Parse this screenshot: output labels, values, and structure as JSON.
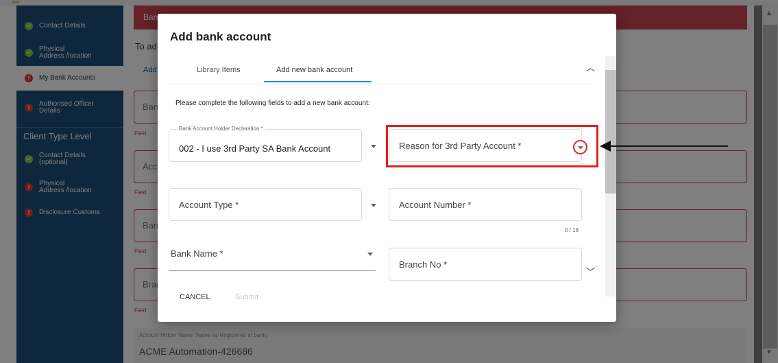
{
  "sidebar": {
    "items": [
      {
        "label": "Contact Details",
        "status": "ok",
        "active": false
      },
      {
        "label": "Physical\nAddress /location",
        "status": "ok",
        "active": false
      },
      {
        "label": "My Bank Accounts",
        "status": "error",
        "active": true
      },
      {
        "label": "Authorised Officer\nDetails",
        "status": "error",
        "active": false
      }
    ],
    "section_title": "Client Type Level",
    "section_items": [
      {
        "label": "Contact Details\n(optional)",
        "status": "ok"
      },
      {
        "label": "Physical\nAddress /location",
        "status": "error"
      },
      {
        "label": "Disclosure Customs",
        "status": "error"
      }
    ]
  },
  "background": {
    "banner_text": "Ban",
    "intro_text": "To ad",
    "add_link": "Add",
    "fields": [
      {
        "label": "Ban",
        "hint": "Field"
      },
      {
        "label": "Acc",
        "hint": "Field"
      },
      {
        "label": "Ban",
        "hint": "Field"
      },
      {
        "label": "Brar",
        "hint": "Field"
      }
    ],
    "holder_label": "Account Holder Name (Name as Registered at bank)",
    "holder_value": "ACME Automation-426686"
  },
  "dialog": {
    "title": "Add bank account",
    "tabs": [
      {
        "label": "Library Items",
        "active": false
      },
      {
        "label": "Add new bank account",
        "active": true
      }
    ],
    "instructions": "Please complete the following fields to add a new bank account:",
    "declaration": {
      "mini_label": "Bank Account Holder Declaration *",
      "value": "002 - I use 3rd Party SA Bank Account"
    },
    "reason_placeholder": "Reason for 3rd Party Account *",
    "account_type_placeholder": "Account Type *",
    "account_number_placeholder": "Account Number *",
    "account_number_counter": "0 / 18",
    "bank_name_placeholder": "Bank Name *",
    "branch_no_placeholder": "Branch No *",
    "cancel_label": "CANCEL",
    "submit_label": "Submit"
  },
  "colors": {
    "sidebar_bg": "#1d4f7a",
    "error_red": "#c9434f",
    "ok_green": "#8bc34a",
    "tab_active": "#1e88e5",
    "annotation_red": "#e02020"
  }
}
